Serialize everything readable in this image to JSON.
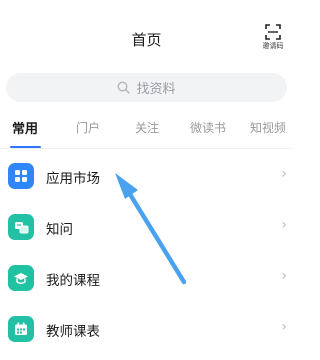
{
  "header": {
    "title": "首页",
    "invite_label": "邀请码",
    "invite_icon": "scan-qr-icon"
  },
  "search": {
    "placeholder": "找资料",
    "icon": "search-icon"
  },
  "tabs": [
    {
      "label": "常用",
      "active": true
    },
    {
      "label": "门户",
      "active": false
    },
    {
      "label": "关注",
      "active": false
    },
    {
      "label": "微读书",
      "active": false
    },
    {
      "label": "知视频",
      "active": false
    }
  ],
  "colors": {
    "accent": "#2f76ff",
    "annotation_arrow": "#4aa2ee"
  },
  "list": [
    {
      "label": "应用市场",
      "icon": "app-grid-icon",
      "color": "#2f86f6"
    },
    {
      "label": "知问",
      "icon": "chat-icon",
      "color": "#22c0a4"
    },
    {
      "label": "我的课程",
      "icon": "graduation-cap-icon",
      "color": "#1fc3a1"
    },
    {
      "label": "教师课表",
      "icon": "calendar-icon",
      "color": "#22c0a4"
    }
  ]
}
